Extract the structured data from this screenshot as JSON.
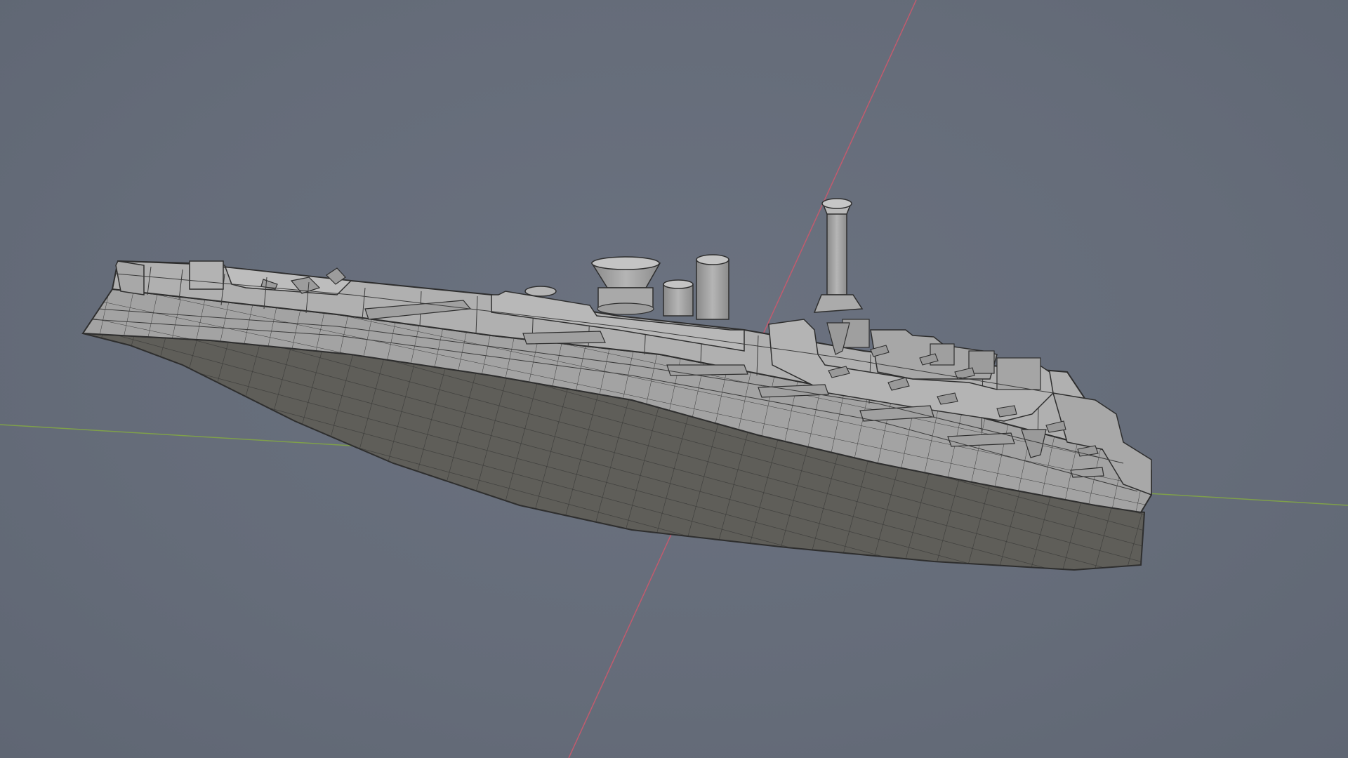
{
  "viewport": {
    "background": "#676e7b",
    "x_axis_color": "#c25b6e",
    "y_axis_color": "#7fa04a",
    "mesh_face_color": "#9b9b9b",
    "mesh_underside_color": "#5e5d58",
    "wire_color": "#2e2e2e"
  },
  "model": {
    "object": "battleship-mesh",
    "display_mode": "solid-with-wireframe"
  }
}
